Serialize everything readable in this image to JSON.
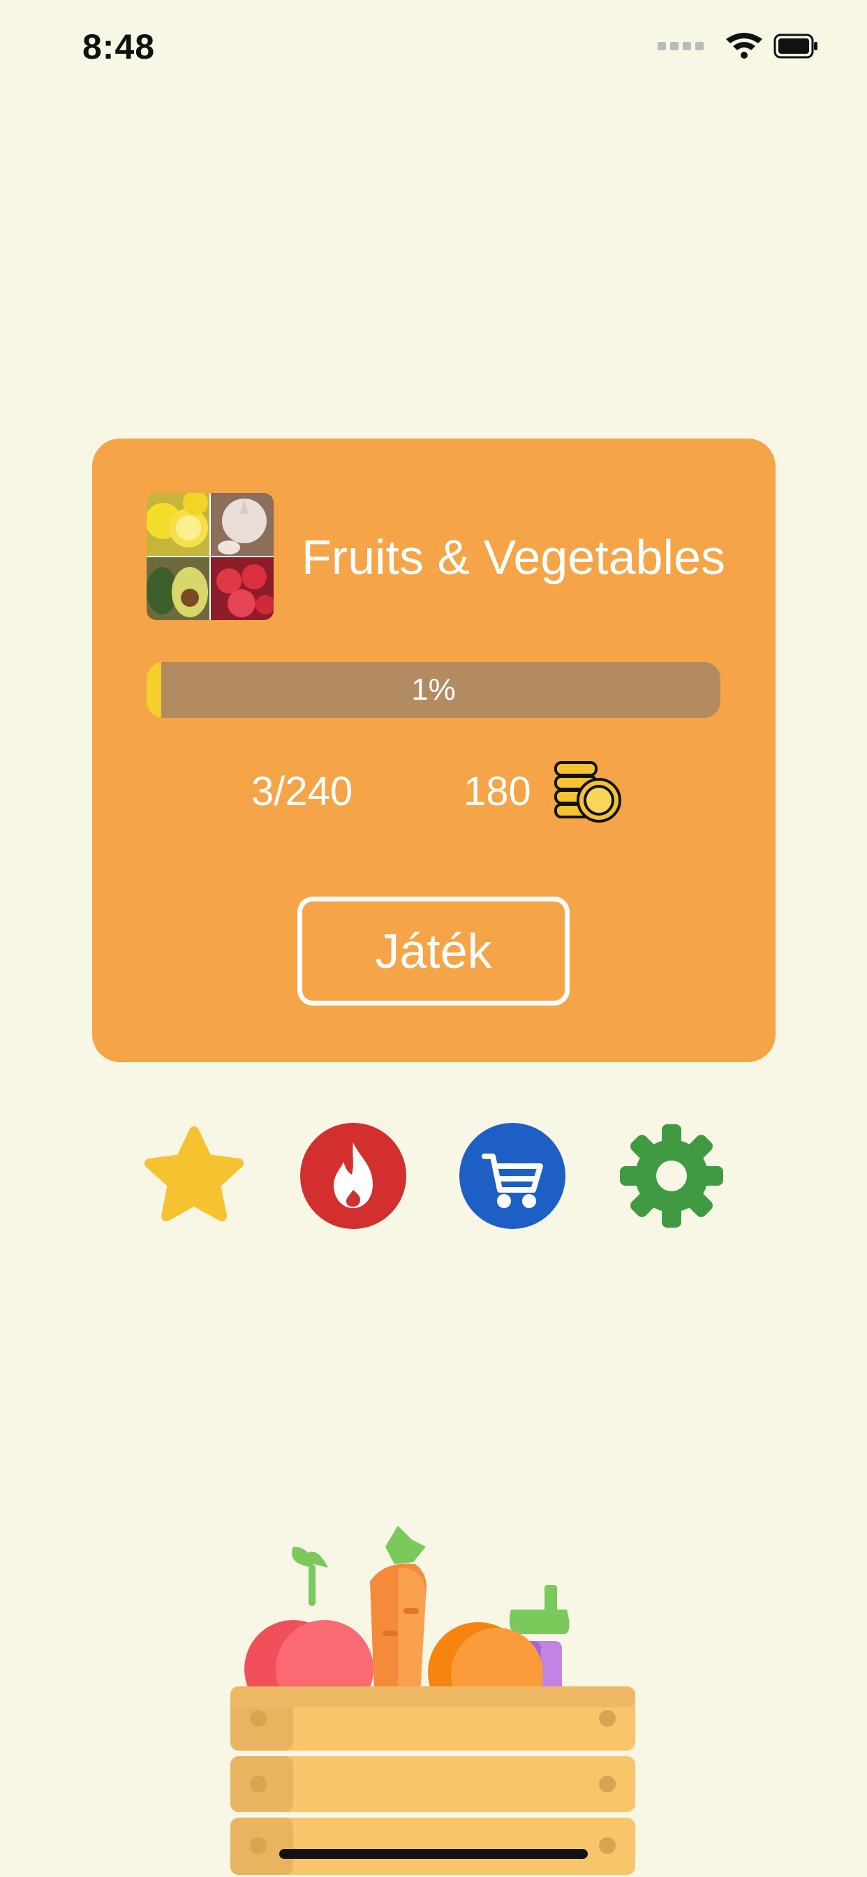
{
  "status_bar": {
    "time": "8:48"
  },
  "category": {
    "title": "Fruits & Vegetables",
    "progress_text": "1%",
    "progress_value": 0.0125,
    "solved_count": "3/240",
    "coins": "180"
  },
  "play_button": {
    "label": "Játék"
  },
  "actions": [
    {
      "icon": "star-icon",
      "color": "#f6c22f"
    },
    {
      "icon": "fire-icon",
      "color": "#d32f2f"
    },
    {
      "icon": "cart-icon",
      "color": "#1d5fc4"
    },
    {
      "icon": "gear-icon",
      "color": "#3f9a41"
    }
  ],
  "colors": {
    "background": "#f8f7e6",
    "card": "#f5a447",
    "progress_track": "#b28b61",
    "progress_fill": "#f6cf2c"
  }
}
